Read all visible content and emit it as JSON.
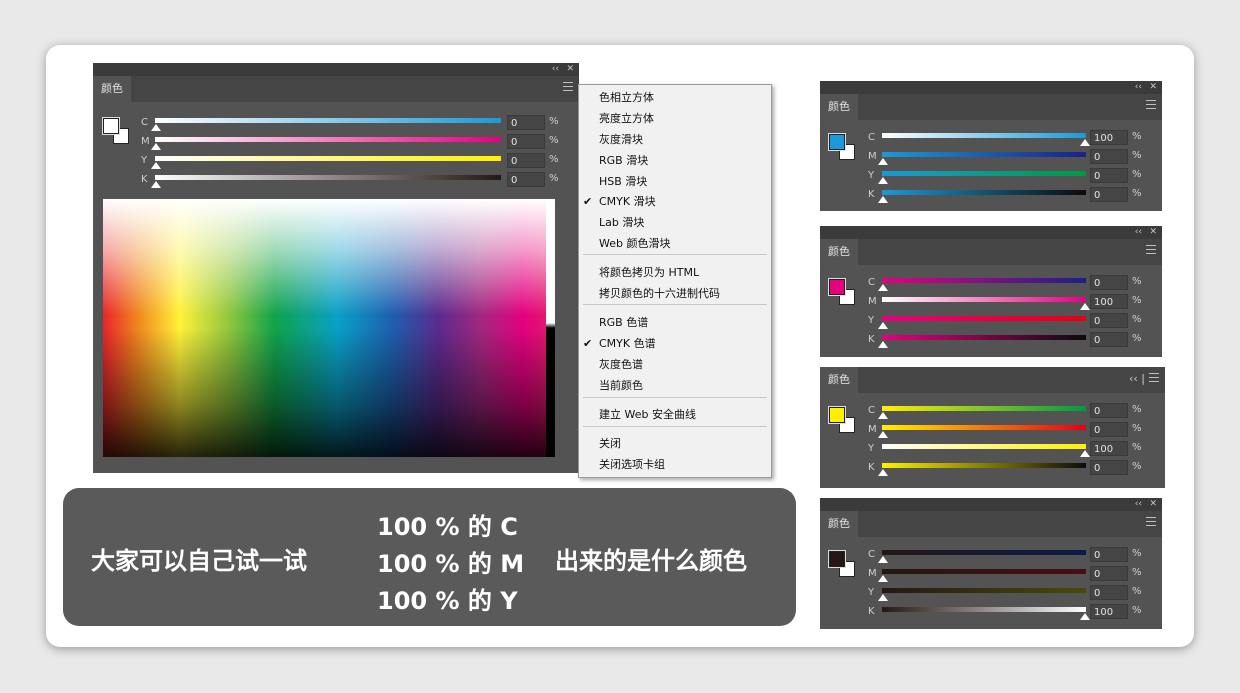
{
  "big_panel": {
    "tab": "颜色",
    "swatch_fg": "#ffffff",
    "sliders": [
      {
        "label": "C",
        "value": "0",
        "unit": "%"
      },
      {
        "label": "M",
        "value": "0",
        "unit": "%"
      },
      {
        "label": "Y",
        "value": "0",
        "unit": "%"
      },
      {
        "label": "K",
        "value": "0",
        "unit": "%"
      }
    ]
  },
  "menu": {
    "items": [
      {
        "label": "色相立方体",
        "checked": false
      },
      {
        "label": "亮度立方体",
        "checked": false
      },
      {
        "label": "灰度滑块",
        "checked": false
      },
      {
        "label": "RGB 滑块",
        "checked": false
      },
      {
        "label": "HSB 滑块",
        "checked": false
      },
      {
        "label": "CMYK 滑块",
        "checked": true
      },
      {
        "label": "Lab 滑块",
        "checked": false
      },
      {
        "label": "Web 颜色滑块",
        "checked": false
      },
      {
        "label": "将颜色拷贝为 HTML",
        "checked": false
      },
      {
        "label": "拷贝颜色的十六进制代码",
        "checked": false
      },
      {
        "label": "RGB 色谱",
        "checked": false
      },
      {
        "label": "CMYK 色谱",
        "checked": true
      },
      {
        "label": "灰度色谱",
        "checked": false
      },
      {
        "label": "当前颜色",
        "checked": false
      },
      {
        "label": "建立 Web 安全曲线",
        "checked": false
      },
      {
        "label": "关闭",
        "checked": false
      },
      {
        "label": "关闭选项卡组",
        "checked": false
      }
    ],
    "check_glyph": "✔"
  },
  "small_panels": [
    {
      "tab": "颜色",
      "swatch": "#1a9ad6",
      "values": [
        "100",
        "0",
        "0",
        "0"
      ],
      "collapse": "‹‹ | "
    },
    {
      "tab": "颜色",
      "swatch": "#e4007f",
      "values": [
        "0",
        "100",
        "0",
        "0"
      ],
      "collapse": "‹‹ | "
    },
    {
      "tab": "颜色",
      "swatch": "#fff000",
      "values": [
        "0",
        "0",
        "100",
        "0"
      ],
      "collapse": "‹‹ | "
    },
    {
      "tab": "颜色",
      "swatch": "#231815",
      "values": [
        "0",
        "0",
        "0",
        "100"
      ],
      "collapse": "‹‹ | "
    }
  ],
  "slider_labels": [
    "C",
    "M",
    "Y",
    "K"
  ],
  "unit": "%",
  "window_controls": {
    "collapse": "‹‹",
    "close": "✕"
  },
  "callout": {
    "left": "大家可以自己试一试",
    "lines": [
      "100 % 的 C",
      "100 % 的 M",
      "100 % 的 Y"
    ],
    "right": "出来的是什么颜色"
  }
}
